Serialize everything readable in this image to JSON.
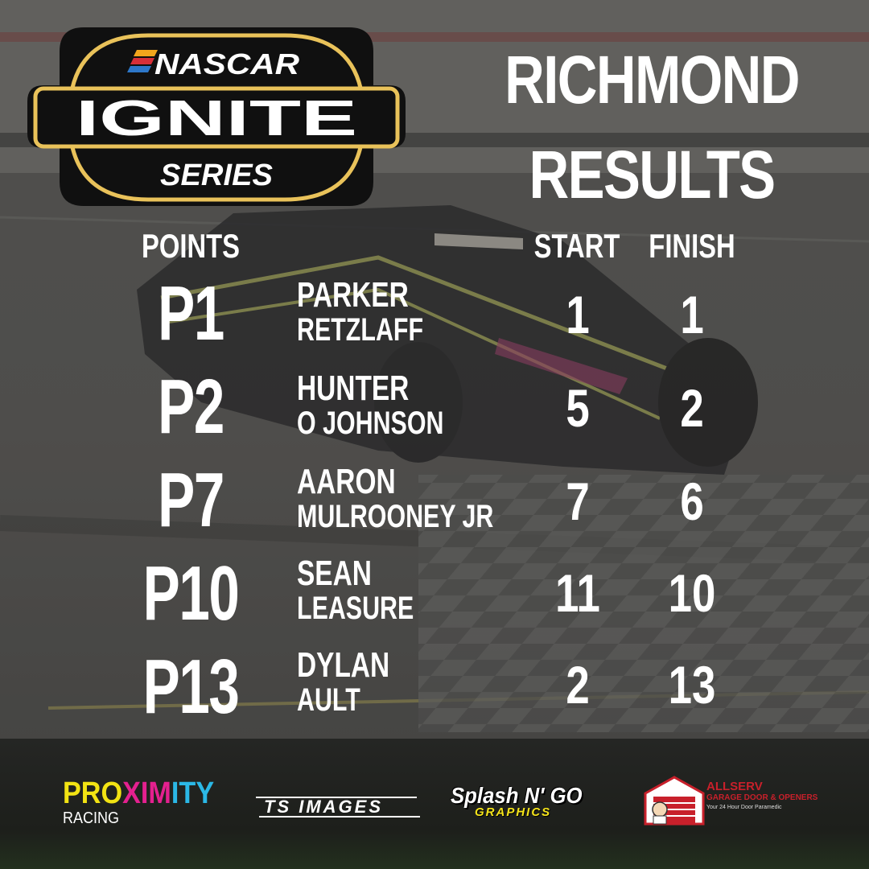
{
  "title": {
    "line1": "RICHMOND",
    "line2": "RESULTS"
  },
  "logo": {
    "brand": "NASCAR",
    "series_name": "IGNITE",
    "series_word": "SERIES"
  },
  "headers": {
    "points": "POINTS",
    "start": "START",
    "finish": "FINISH"
  },
  "results": [
    {
      "points": "P1",
      "first": "PARKER",
      "last": "RETZLAFF",
      "start": "1",
      "finish": "1"
    },
    {
      "points": "P2",
      "first": "HUNTER",
      "last": "O JOHNSON",
      "start": "5",
      "finish": "2"
    },
    {
      "points": "P7",
      "first": "AARON",
      "last": "MULROONEY JR",
      "start": "7",
      "finish": "6"
    },
    {
      "points": "P10",
      "first": "SEAN",
      "last": "LEASURE",
      "start": "11",
      "finish": "10"
    },
    {
      "points": "P13",
      "first": "DYLAN",
      "last": "AULT",
      "start": "2",
      "finish": "13"
    }
  ],
  "sponsors": {
    "proximity": {
      "pro": "PRO",
      "xim": "XIM",
      "ity": "ITY",
      "sub": "RACING"
    },
    "ts_images": "TS IMAGES",
    "splash": {
      "main": "Splash N' GO",
      "sub": "GRAPHICS"
    },
    "allserv": {
      "name": "ALLSERV",
      "line2": "GARAGE DOOR & OPENERS",
      "tagline": "Your 24 Hour Door Paramedic"
    }
  },
  "colors": {
    "gold": "#e9c25a",
    "logo_bg": "#101010",
    "proximity_yellow": "#f2e313",
    "proximity_magenta": "#e4208f",
    "proximity_cyan": "#2bb8e6",
    "splash_yellow": "#f5e41a",
    "allserv_red": "#c8202b"
  }
}
